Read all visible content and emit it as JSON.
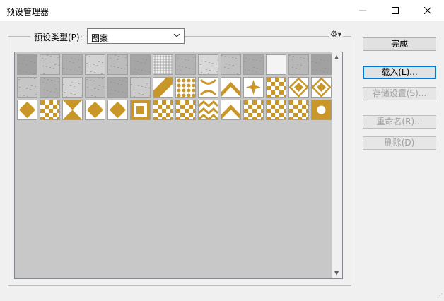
{
  "window": {
    "title": "预设管理器",
    "minimize_label": "—",
    "maximize_label": "☐",
    "close_label": "✕"
  },
  "preset": {
    "type_label": "预设类型(P):",
    "type_value": "图案",
    "chevron": "⌄",
    "gear_label": "⚙▾"
  },
  "buttons": {
    "done": "完成",
    "load": "载入(L)...",
    "save_set": "存储设置(S)...",
    "rename": "重命名(R)...",
    "delete": "删除(D)"
  },
  "scrollbar": {
    "up": "▲",
    "down": "▼"
  },
  "tiles": {
    "count": 40,
    "per_row": 14,
    "kinds": [
      "gray",
      "gray",
      "gray",
      "gray",
      "gray",
      "gray",
      "grid",
      "gray",
      "gray",
      "gray",
      "gray",
      "white",
      "gray",
      "gray",
      "gray",
      "gray",
      "gray",
      "gray",
      "gray",
      "gray",
      "diag",
      "gold-dots",
      "gold-cross",
      "gold-chev",
      "gold-star",
      "gold-check",
      "gold-diamond",
      "gold-diamond2",
      "gold-x",
      "gold-check",
      "gold-hourglass",
      "gold-x",
      "gold-x",
      "gold-frame",
      "gold-check",
      "gold-check",
      "gold-zig",
      "gold-chev2",
      "gold-check",
      "gold-check",
      "gold-check",
      "gold-circle"
    ],
    "colors": {
      "gold": "#c9962a",
      "gray": "#c0c0c0",
      "light": "#eeeeee"
    }
  }
}
